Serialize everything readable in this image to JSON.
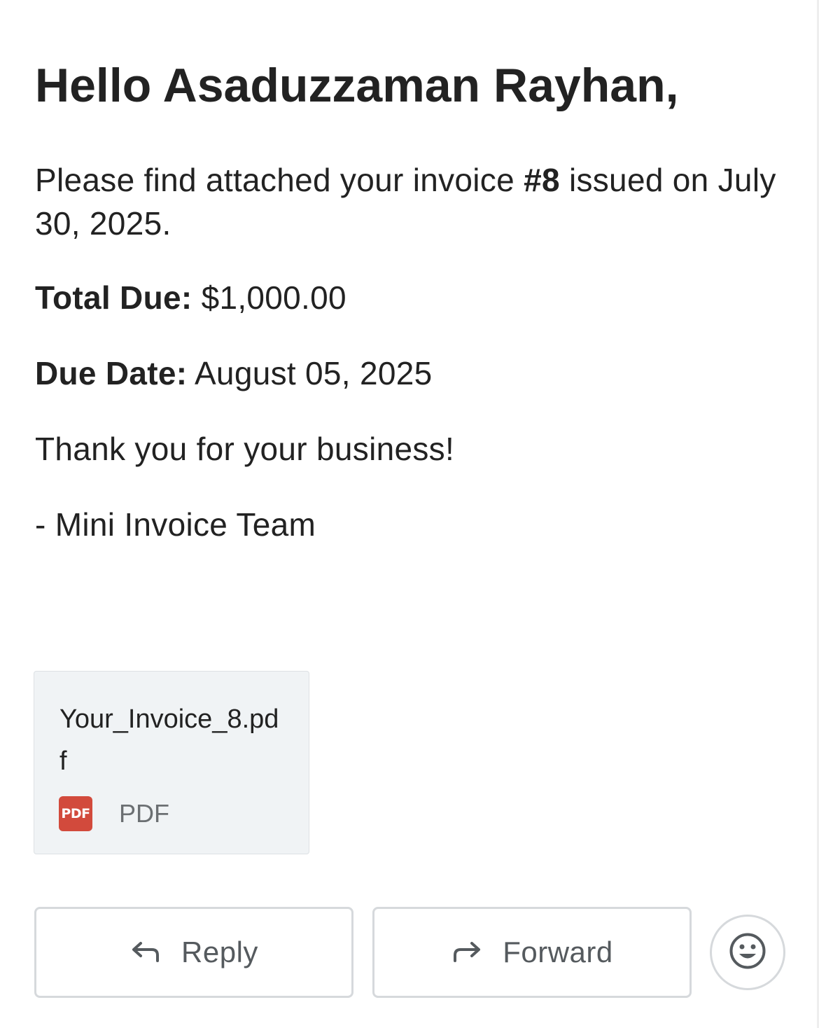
{
  "email": {
    "greeting": "Hello Asaduzzaman Rayhan,",
    "intro_prefix": "Please find attached your invoice ",
    "invoice_number": "#8",
    "intro_suffix": " issued on July 30, 2025.",
    "total_due_label": "Total Due:",
    "total_due_value": "$1,000.00",
    "due_date_label": "Due Date:",
    "due_date_value": "August 05, 2025",
    "thanks": "Thank you for your business!",
    "signature": "- Mini Invoice Team"
  },
  "attachment": {
    "file_name": "Your_Invoice_8.pdf",
    "icon_text": "PDF",
    "file_type": "PDF",
    "icon": "pdf-file-icon",
    "icon_color": "#d24a3c"
  },
  "actions": {
    "reply_label": "Reply",
    "reply_icon": "reply-arrow-icon",
    "forward_label": "Forward",
    "forward_icon": "forward-arrow-icon",
    "emoji_icon": "smiley-face-icon"
  }
}
